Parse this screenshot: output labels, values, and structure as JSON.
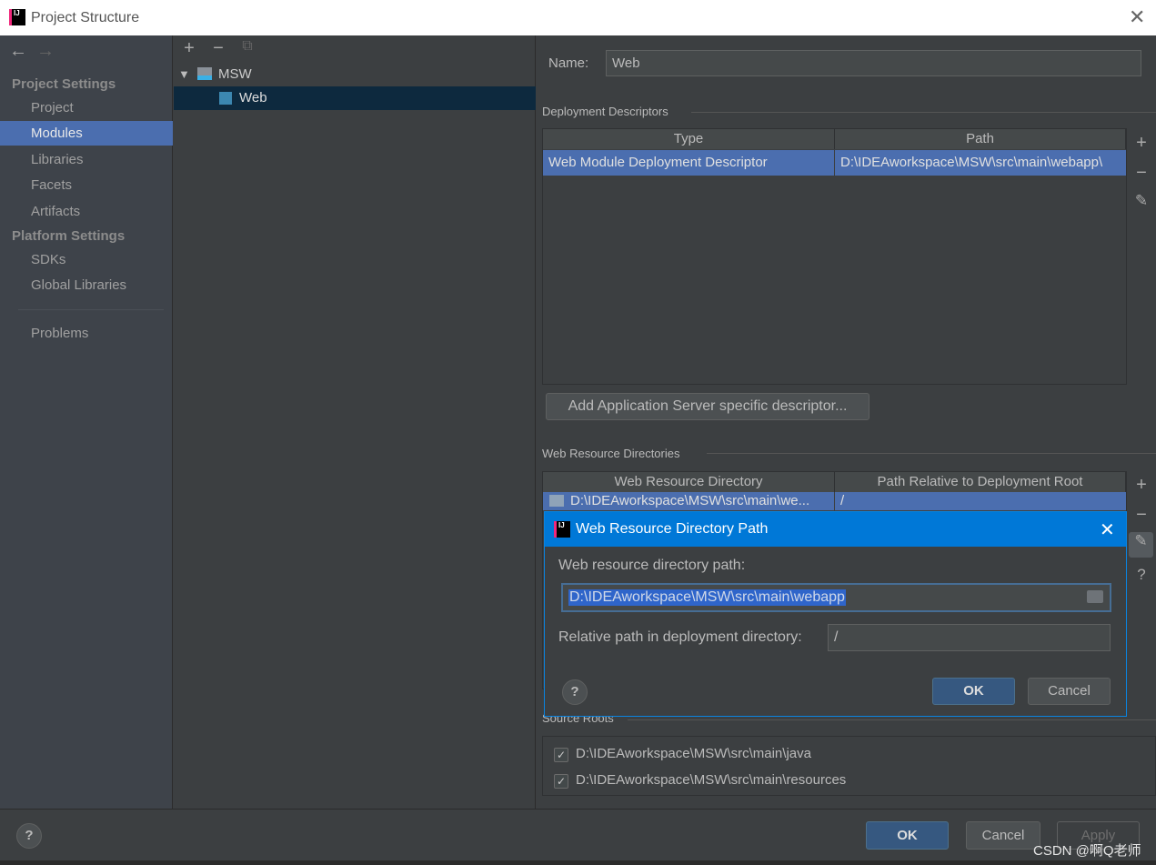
{
  "window": {
    "title": "Project Structure"
  },
  "sidebar": {
    "back_icon": "arrow-left-icon",
    "forward_icon": "arrow-right-icon",
    "section1": "Project Settings",
    "items1": [
      "Project",
      "Modules",
      "Libraries",
      "Facets",
      "Artifacts"
    ],
    "section2": "Platform Settings",
    "items2": [
      "SDKs",
      "Global Libraries"
    ],
    "problems": "Problems",
    "selected": "Modules"
  },
  "tree": {
    "toolbar": [
      "plus-icon",
      "minus-icon",
      "copy-icon"
    ],
    "root": "MSW",
    "child": "Web"
  },
  "main": {
    "name_label": "Name:",
    "name_value": "Web",
    "deployment": {
      "title": "Deployment Descriptors",
      "columns": [
        "Type",
        "Path"
      ],
      "rows": [
        [
          "Web Module Deployment Descriptor",
          "D:\\IDEAworkspace\\MSW\\src\\main\\webapp\\"
        ]
      ],
      "add_button": "Add Application Server specific descriptor..."
    },
    "web_resources": {
      "title": "Web Resource Directories",
      "columns": [
        "Web Resource Directory",
        "Path Relative to Deployment Root"
      ],
      "rows": [
        [
          "D:\\IDEAworkspace\\MSW\\src\\main\\we...",
          "/"
        ]
      ]
    },
    "source_roots": {
      "title": "Source Roots",
      "items": [
        {
          "path": "D:\\IDEAworkspace\\MSW\\src\\main\\java",
          "checked": true
        },
        {
          "path": "D:\\IDEAworkspace\\MSW\\src\\main\\resources",
          "checked": true
        }
      ]
    }
  },
  "dialog": {
    "title": "Web Resource Directory Path",
    "path_label": "Web resource directory path:",
    "path_value": "D:\\IDEAworkspace\\MSW\\src\\main\\webapp",
    "relative_label": "Relative path in deployment directory:",
    "relative_value": "/",
    "ok": "OK",
    "cancel": "Cancel",
    "help": "?"
  },
  "footer": {
    "help": "?",
    "ok": "OK",
    "cancel": "Cancel",
    "apply": "Apply"
  },
  "watermark": "CSDN @啊Q老师",
  "colors": {
    "selection": "#4b6eaf",
    "dialog_title": "#0078d7",
    "default_button": "#365880"
  }
}
